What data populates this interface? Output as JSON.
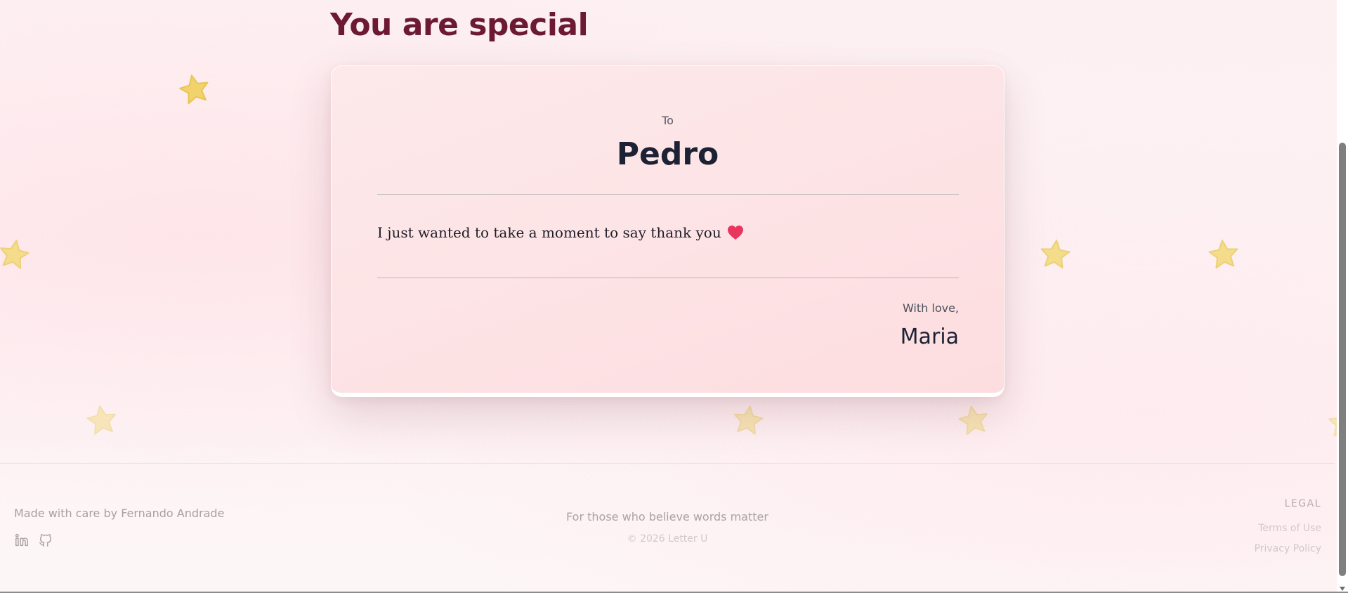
{
  "page": {
    "title": "You are special"
  },
  "letter": {
    "to_label": "To",
    "recipient": "Pedro",
    "message": "I just wanted to take a moment to say thank you",
    "message_icon": "heart-icon",
    "closing": "With love,",
    "sender": "Maria"
  },
  "decorations": {
    "icon": "star-icon",
    "star_color": "#f2d36b"
  },
  "footer": {
    "credit": "Made with care by Fernando Andrade",
    "social": [
      {
        "icon": "linkedin-icon"
      },
      {
        "icon": "github-icon"
      }
    ],
    "tagline": "For those who believe words matter",
    "copyright": "© 2026 Letter U",
    "legal_title": "LEGAL",
    "legal_links": [
      "Terms of Use",
      "Privacy Policy"
    ]
  },
  "colors": {
    "title": "#6b1a32",
    "heart": "#e8375f",
    "card_bg": "#fde4e6"
  }
}
